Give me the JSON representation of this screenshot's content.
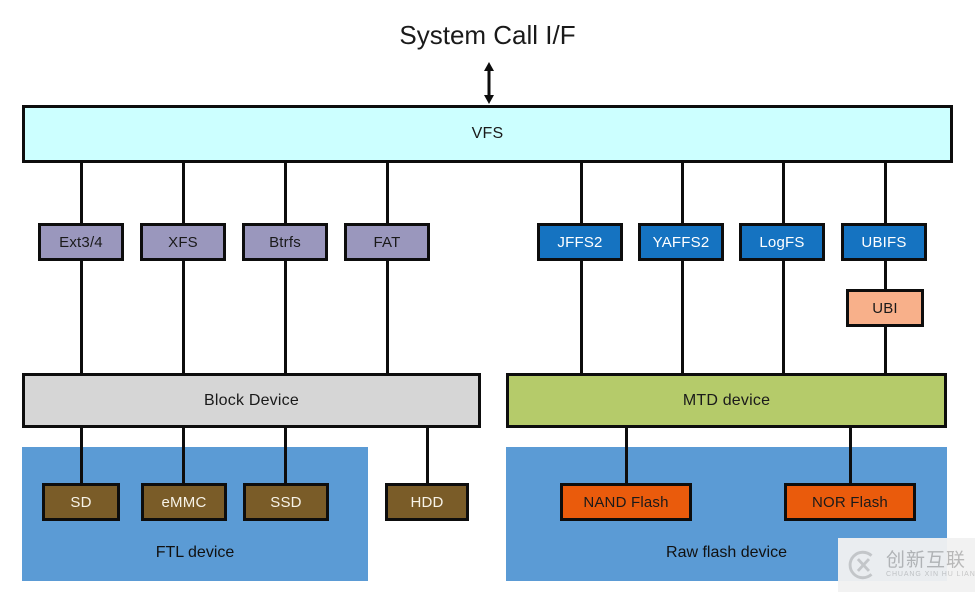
{
  "diagram": {
    "title": "System Call I/F",
    "arrow": "double-headed-vertical-arrow",
    "vfs": {
      "label": "VFS"
    },
    "block_filesystems": [
      {
        "label": "Ext3/4"
      },
      {
        "label": "XFS"
      },
      {
        "label": "Btrfs"
      },
      {
        "label": "FAT"
      }
    ],
    "flash_filesystems": [
      {
        "label": "JFFS2"
      },
      {
        "label": "YAFFS2"
      },
      {
        "label": "LogFS"
      },
      {
        "label": "UBIFS"
      }
    ],
    "ubi": {
      "label": "UBI"
    },
    "block_device": {
      "label": "Block Device"
    },
    "mtd_device": {
      "label": "MTD device"
    },
    "block_media": [
      {
        "label": "SD"
      },
      {
        "label": "eMMC"
      },
      {
        "label": "SSD"
      },
      {
        "label": "HDD"
      }
    ],
    "flash_media": [
      {
        "label": "NAND Flash"
      },
      {
        "label": "NOR Flash"
      }
    ],
    "regions": [
      {
        "label": "FTL device"
      },
      {
        "label": "Raw flash device"
      }
    ]
  },
  "watermark": {
    "logo": "cx-circle-logo",
    "chinese": "创新互联",
    "pinyin": "CHUANG XIN HU LIAN"
  },
  "colors": {
    "vfs": "#ccffff",
    "filesystem": "#9a97bd",
    "flash_filesystem": "#1573c1",
    "ubi": "#f8b08a",
    "block_device": "#d6d6d6",
    "mtd_device": "#b5cb6a",
    "disk": "#7a5c28",
    "flash": "#ea5b0c",
    "region": "#5b9bd5",
    "stroke": "#0d0d0d"
  }
}
